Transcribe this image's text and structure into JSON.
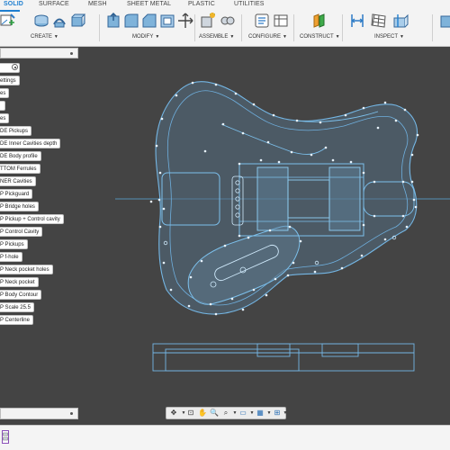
{
  "toolbar": {
    "tabs": [
      {
        "label": "SOLID",
        "active": true
      },
      {
        "label": "SURFACE",
        "active": false
      },
      {
        "label": "MESH",
        "active": false
      },
      {
        "label": "SHEET METAL",
        "active": false
      },
      {
        "label": "PLASTIC",
        "active": false
      },
      {
        "label": "UTILITIES",
        "active": false
      }
    ],
    "groups": [
      "CREATE",
      "MODIFY",
      "ASSEMBLE",
      "CONFIGURE",
      "CONSTRUCT",
      "INSPECT"
    ],
    "colors": {
      "accent": "#1f7fd0",
      "toolbar_bg": "#f3f3f3",
      "viewport_bg": "#444444",
      "sketch_line": "#6fb3e0"
    }
  },
  "browser": {
    "items": [
      "",
      "ettings",
      "es",
      "",
      "es",
      "DE Pickups",
      "DE Inner Cavities depth",
      "DE Body profile",
      "TTOM Ferrules",
      "NER Cavities",
      "P Pickguard",
      "P Bridge holes",
      "P Pickup + Control cavity",
      "P Control Cavity",
      "P Pickups",
      "P f-hole",
      "P Neck pocket holes",
      "P Neck pocket",
      "P Body Contour",
      "P Scale 25.5",
      "P Centerline"
    ]
  },
  "icons": {
    "menu": "caret-down-icon",
    "nav": [
      "orbit-icon",
      "look-at-icon",
      "pan-icon",
      "zoom-icon",
      "fit-icon",
      "display-settings-icon",
      "grid-icon",
      "viewports-icon"
    ]
  }
}
